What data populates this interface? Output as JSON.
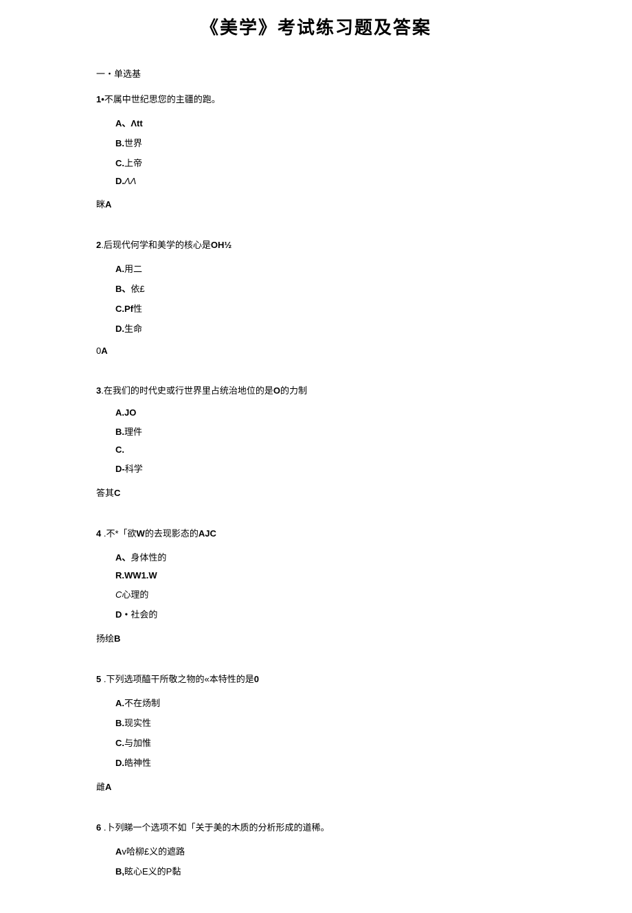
{
  "title": "《美学》考试练习题及答案",
  "section_header": "一・单选基",
  "questions": [
    {
      "num": "1•",
      "stem_text": "不属中世纪思您的主疆的跑。",
      "options": [
        {
          "label": "A、",
          "text": "Λtt",
          "bold_text": true
        },
        {
          "label": "B.",
          "text": "世界"
        },
        {
          "label": "C.",
          "text": "上帝"
        },
        {
          "label": "D.",
          "text": "ΛΛ",
          "italic_text": true
        }
      ],
      "answer_label": "眯",
      "answer_value": "A"
    },
    {
      "num": "2",
      "stem_text": ".后现代何学和美学的核心是",
      "stem_suffix": "OH½",
      "options": [
        {
          "label": "A.",
          "text": "用二"
        },
        {
          "label": "B、",
          "text": "依£"
        },
        {
          "label": "C.Pf",
          "text": "性"
        },
        {
          "label": "D.",
          "text": "生命"
        }
      ],
      "answer_label": "0",
      "answer_value": "A"
    },
    {
      "num": "3",
      "stem_text": ".在我们的时代史或行世界里占统治地位的是",
      "stem_mid": "O",
      "stem_end": "的力制",
      "options": [
        {
          "label": "A.JO",
          "text": ""
        },
        {
          "label": "B.",
          "text": "理件"
        },
        {
          "label": "C.",
          "text": ""
        },
        {
          "label": "D-",
          "text": "科学"
        }
      ],
      "answer_label": "答其",
      "answer_value": "C"
    },
    {
      "num": "4",
      "num_spaced": true,
      "stem_text": " .不*「欲",
      "stem_mid": "W",
      "stem_end": "的去现影态的",
      "stem_suffix": "AJC",
      "options": [
        {
          "label": "A、",
          "text": "身体性的"
        },
        {
          "label": "R.WW1.W",
          "text": "",
          "bold_label": true
        },
        {
          "label": "C",
          "text": "心理的",
          "italic_label": true,
          "no_bold": true
        },
        {
          "label": "D・",
          "text": "社会的"
        }
      ],
      "answer_label": "扬绘",
      "answer_value": "B"
    },
    {
      "num": "5",
      "num_spaced": true,
      "stem_text": " .下列选项醯干所敬之物的«本特性的是",
      "stem_suffix": "0",
      "options": [
        {
          "label": "A.",
          "text": "不在炀制"
        },
        {
          "label": "B.",
          "text": "现实性"
        },
        {
          "label": "C.",
          "text": "与加惟"
        },
        {
          "label": "D.",
          "text": "皓神性"
        }
      ],
      "answer_label": "雌",
      "answer_value": "A"
    },
    {
      "num": "6",
      "num_spaced": true,
      "stem_text": " .卜列睇一个选项不如「关于美的木质的分析形成的道稀。",
      "options": [
        {
          "label": "A",
          "text": "v哈柳£义的遮路"
        },
        {
          "label": "B,",
          "text": "眩心E义的P黏"
        }
      ]
    }
  ]
}
